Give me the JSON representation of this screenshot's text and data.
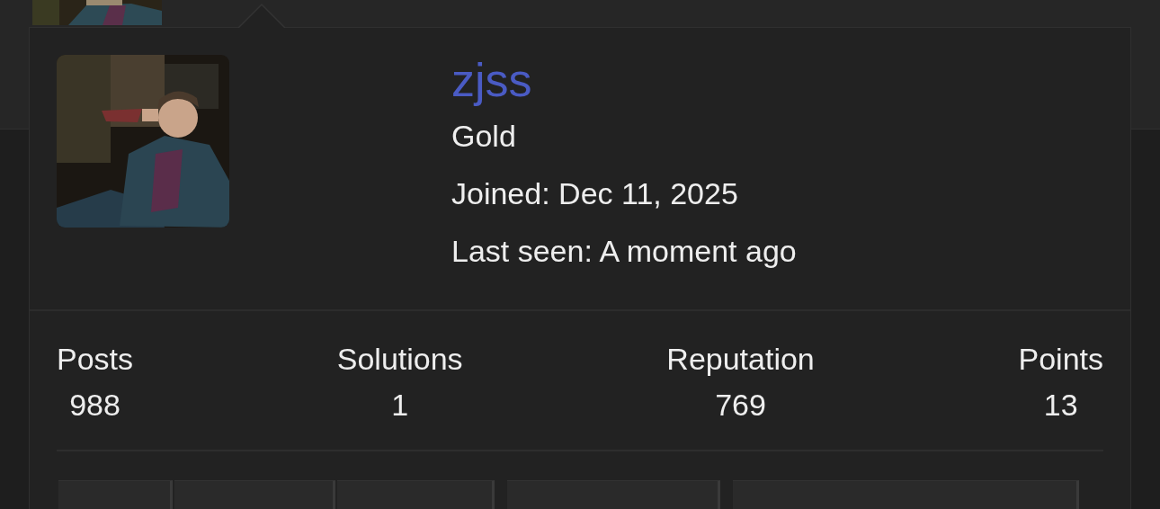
{
  "profile": {
    "name": "zjss",
    "rank": "Gold",
    "joined": "Joined: Dec 11, 2025",
    "last_seen": "Last seen: A moment ago"
  },
  "stats": [
    {
      "label": "Posts",
      "value": "988"
    },
    {
      "label": "Solutions",
      "value": "1"
    },
    {
      "label": "Reputation",
      "value": "769"
    },
    {
      "label": "Points",
      "value": "13"
    }
  ]
}
